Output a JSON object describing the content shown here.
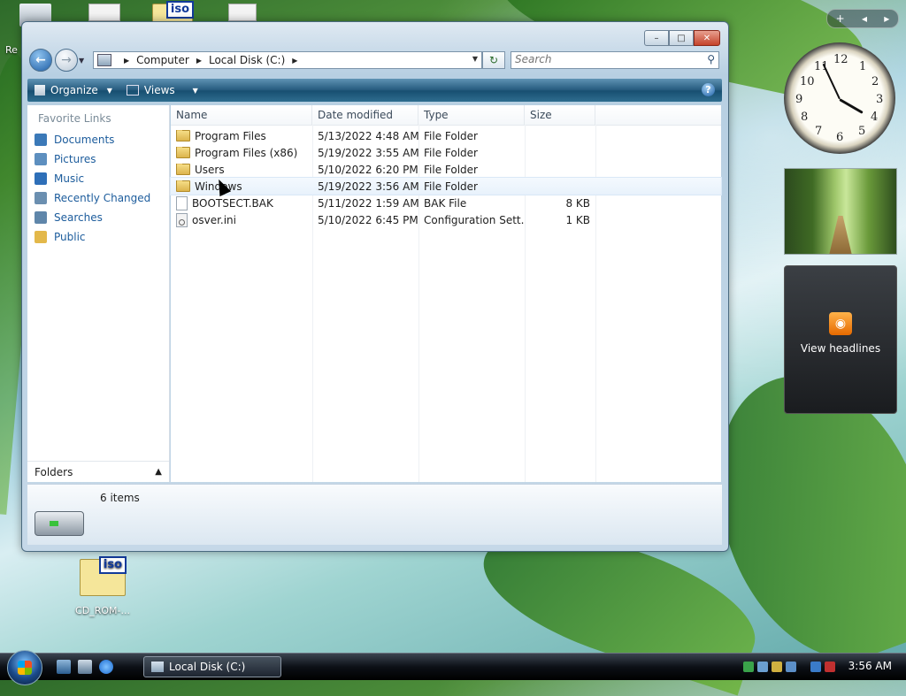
{
  "desktop": {
    "icons": [
      {
        "label": "Re",
        "name": "recycle-bin"
      },
      {
        "label": "CD_ROM-...",
        "name": "cd-rom-iso"
      }
    ],
    "iso_badge": "iso"
  },
  "window": {
    "address": [
      "Computer",
      "Local Disk (C:)"
    ],
    "search_placeholder": "Search",
    "toolbar": {
      "organize": "Organize",
      "views": "Views",
      "help": "?"
    }
  },
  "nav": {
    "header": "Favorite Links",
    "items": [
      {
        "label": "Documents",
        "color": "#3b79b8"
      },
      {
        "label": "Pictures",
        "color": "#5d8fbf"
      },
      {
        "label": "Music",
        "color": "#2e6fb8"
      },
      {
        "label": "Recently Changed",
        "color": "#6b8fb0"
      },
      {
        "label": "Searches",
        "color": "#5f86aa"
      },
      {
        "label": "Public",
        "color": "#e3b84a"
      }
    ],
    "folders_label": "Folders"
  },
  "columns": [
    "Name",
    "Date modified",
    "Type",
    "Size"
  ],
  "files": [
    {
      "name": "Program Files",
      "date": "5/13/2022 4:48 AM",
      "type": "File Folder",
      "size": "",
      "kind": "folder"
    },
    {
      "name": "Program Files (x86)",
      "date": "5/19/2022 3:55 AM",
      "type": "File Folder",
      "size": "",
      "kind": "folder"
    },
    {
      "name": "Users",
      "date": "5/10/2022 6:20 PM",
      "type": "File Folder",
      "size": "",
      "kind": "folder"
    },
    {
      "name": "Windows",
      "date": "5/19/2022 3:56 AM",
      "type": "File Folder",
      "size": "",
      "kind": "folder"
    },
    {
      "name": "BOOTSECT.BAK",
      "date": "5/11/2022 1:59 AM",
      "type": "BAK File",
      "size": "8 KB",
      "kind": "file"
    },
    {
      "name": "osver.ini",
      "date": "5/10/2022 6:45 PM",
      "type": "Configuration Sett...",
      "size": "1 KB",
      "kind": "ini"
    }
  ],
  "details": {
    "count": "6 items"
  },
  "sidebar": {
    "controls": [
      "+",
      "◂",
      "▸"
    ],
    "clock_numbers": [
      "12",
      "1",
      "2",
      "3",
      "4",
      "5",
      "6",
      "7",
      "8",
      "9",
      "10",
      "11"
    ],
    "feed_label": "View headlines"
  },
  "taskbar": {
    "task_label": "Local Disk (C:)",
    "time": "3:56 AM"
  }
}
